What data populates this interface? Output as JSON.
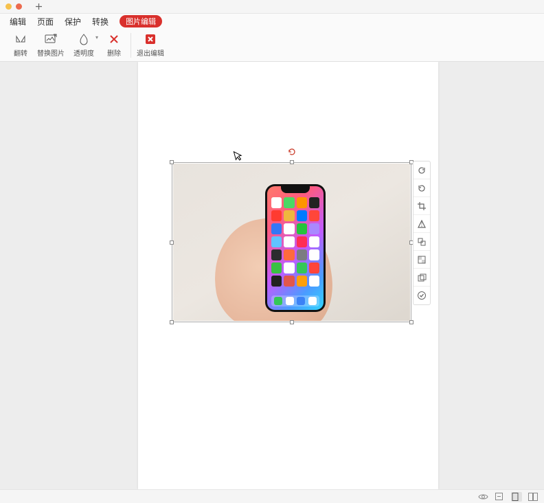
{
  "menus": {
    "edit": "编辑",
    "page": "页面",
    "protect": "保护",
    "convert": "转换",
    "image_edit": "图片编辑"
  },
  "tools": {
    "flip": "翻转",
    "replace": "替换图片",
    "opacity": "透明度",
    "delete": "删除",
    "exit": "退出编辑"
  },
  "float_tools": {
    "rotate_ccw": "rotate-ccw",
    "rotate_cw": "rotate-cw",
    "crop": "crop",
    "flip": "flip",
    "extract": "extract",
    "opacity": "opacity",
    "export": "export",
    "ok": "apply"
  },
  "colors": {
    "accent": "#d9302c"
  },
  "phone_apps": [
    "#ffffff",
    "#4cd964",
    "#ff9500",
    "#222222",
    "#ff3b30",
    "#efb73e",
    "#007aff",
    "#ff463a",
    "#3477f6",
    "#ffffff",
    "#25c33d",
    "#a988ff",
    "#61c3ff",
    "#ffffff",
    "#ff2d55",
    "#ffffff",
    "#2c2c2e",
    "#ff6a3d",
    "#7c7c82",
    "#ffffff",
    "#3ac143",
    "#ffffff",
    "#34c759",
    "#ff453a",
    "#222222",
    "#e2574c",
    "#ff9f0a",
    "#ffffff"
  ],
  "dock_apps": [
    "#34c759",
    "#ffffff",
    "#3b82f6",
    "#ffffff"
  ]
}
